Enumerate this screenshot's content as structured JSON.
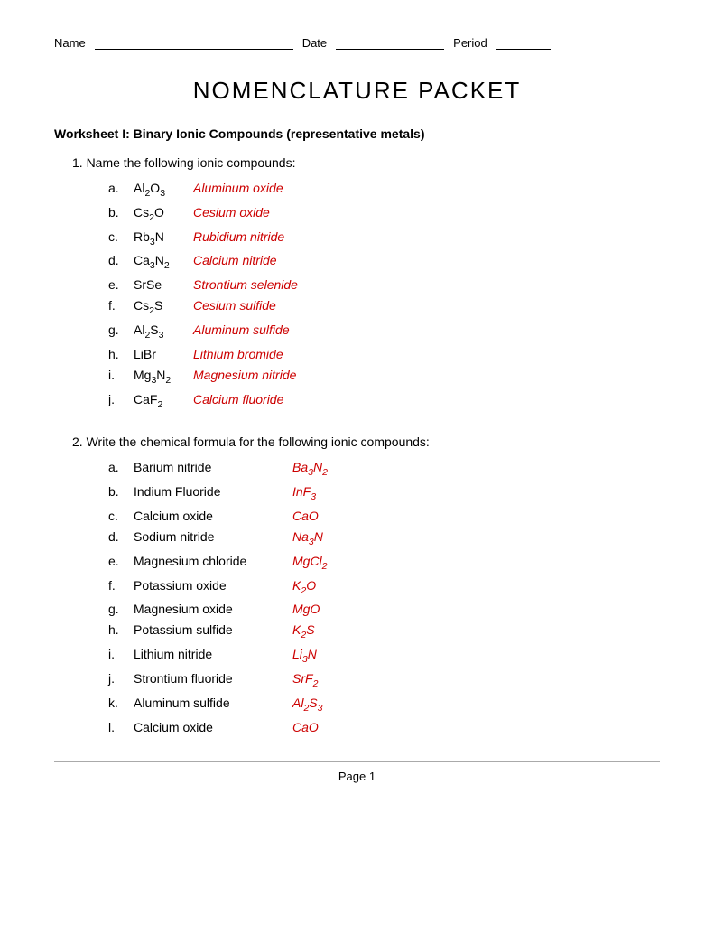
{
  "header": {
    "name_label": "Name",
    "date_label": "Date",
    "period_label": "Period"
  },
  "title": "Nomenclature Packet",
  "worksheet1": {
    "heading": "Worksheet I: Binary Ionic Compounds (representative metals)",
    "q1_intro": "1.   Name the following ionic compounds:",
    "q1_items": [
      {
        "label": "a.",
        "formula_html": "Al₂O₃",
        "answer": "Aluminum oxide"
      },
      {
        "label": "b.",
        "formula_html": "Cs₂O",
        "answer": "Cesium oxide"
      },
      {
        "label": "c.",
        "formula_html": "Rb₃N",
        "answer": "Rubidium nitride"
      },
      {
        "label": "d.",
        "formula_html": "Ca₃N₂",
        "answer": "Calcium nitride"
      },
      {
        "label": "e.",
        "formula_html": "SrSe",
        "answer": "Strontium selenide"
      },
      {
        "label": "f.",
        "formula_html": "Cs₂S",
        "answer": "Cesium sulfide"
      },
      {
        "label": "g.",
        "formula_html": "Al₂S₃",
        "answer": "Aluminum sulfide"
      },
      {
        "label": "h.",
        "formula_html": "LiBr",
        "answer": "Lithium bromide"
      },
      {
        "label": "i.",
        "formula_html": "Mg₃N₂",
        "answer": "Magnesium nitride"
      },
      {
        "label": "j.",
        "formula_html": "CaF₂",
        "answer": "Calcium fluoride"
      }
    ],
    "q2_intro": "2.   Write the chemical formula for the following ionic compounds:",
    "q2_items": [
      {
        "label": "a.",
        "name": "Barium nitride",
        "formula_html": "Ba₃N₂"
      },
      {
        "label": "b.",
        "name": "Indium Fluoride",
        "formula_html": "InF₃"
      },
      {
        "label": "c.",
        "name": "Calcium oxide",
        "formula_html": "CaO"
      },
      {
        "label": "d.",
        "name": "Sodium nitride",
        "formula_html": "Na₃N"
      },
      {
        "label": "e.",
        "name": "Magnesium chloride",
        "formula_html": "MgCl₂"
      },
      {
        "label": "f.",
        "name": "Potassium oxide",
        "formula_html": "K₂O"
      },
      {
        "label": "g.",
        "name": "Magnesium oxide",
        "formula_html": "MgO"
      },
      {
        "label": "h.",
        "name": "Potassium sulfide",
        "formula_html": "K₂S"
      },
      {
        "label": "i.",
        "name": "Lithium nitride",
        "formula_html": "Li₃N"
      },
      {
        "label": "j.",
        "name": "Strontium fluoride",
        "formula_html": "SrF₂"
      },
      {
        "label": "k.",
        "name": "Aluminum sulfide",
        "formula_html": "Al₂S₃"
      },
      {
        "label": "l.",
        "name": "Calcium oxide",
        "formula_html": "CaO"
      }
    ]
  },
  "footer": {
    "page_label": "Page 1"
  }
}
